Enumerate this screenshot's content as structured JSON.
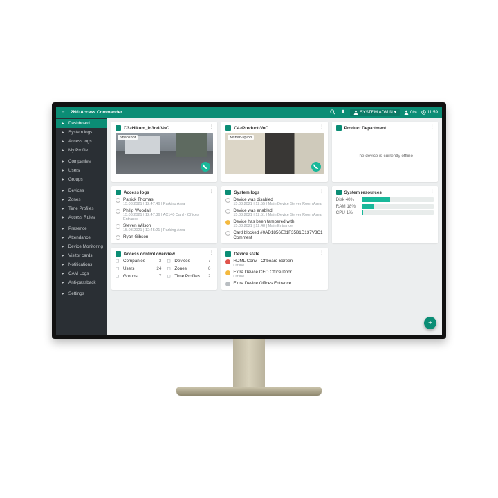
{
  "header": {
    "brand": "2N® Access Commander",
    "user_label": "SYSTEM ADMIN",
    "license": "0/∞",
    "time": "11:59"
  },
  "sidebar": {
    "items": [
      {
        "icon": "dashboard",
        "label": "Dashboard",
        "active": true
      },
      {
        "icon": "log",
        "label": "System logs"
      },
      {
        "icon": "log",
        "label": "Access logs"
      },
      {
        "icon": "user",
        "label": "My Profile"
      },
      {
        "sep": true
      },
      {
        "icon": "building",
        "label": "Companies"
      },
      {
        "icon": "users",
        "label": "Users"
      },
      {
        "icon": "users",
        "label": "Groups"
      },
      {
        "sep": true
      },
      {
        "icon": "device",
        "label": "Devices"
      },
      {
        "icon": "zone",
        "label": "Zones"
      },
      {
        "icon": "clock",
        "label": "Time Profiles"
      },
      {
        "icon": "lock",
        "label": "Access Rules"
      },
      {
        "sep": true
      },
      {
        "icon": "presence",
        "label": "Presence"
      },
      {
        "icon": "attendance",
        "label": "Attendance"
      },
      {
        "icon": "monitor",
        "label": "Device Monitoring"
      },
      {
        "icon": "card",
        "label": "Visitor cards"
      },
      {
        "icon": "bell",
        "label": "Notifications"
      },
      {
        "icon": "camera",
        "label": "CAM Logs"
      },
      {
        "icon": "shield",
        "label": "Anti-passback"
      },
      {
        "sep": true
      },
      {
        "icon": "gear",
        "label": "Settings"
      }
    ]
  },
  "cameras": [
    {
      "title": "C3>Hikum_in3od-VoC",
      "tag": "Snapshot"
    },
    {
      "title": "C4>Product-VoC",
      "tag": "Msnad-vplod"
    },
    {
      "title": "Product Department",
      "offline_text": "The device is currently offline"
    }
  ],
  "access_logs": {
    "title": "Access logs",
    "items": [
      {
        "name": "Patrick Thomas",
        "meta": "15.03.2021 | 12:47:46 | Parking Area"
      },
      {
        "name": "Philip Woodall",
        "meta": "15.03.2021 | 12:47:36 | AC140 Card · Offices Entrance"
      },
      {
        "name": "Steven Wilson",
        "meta": "15.03.2021 | 12:45:21 | Parking Area"
      },
      {
        "name": "Ryan Gibson",
        "meta": ""
      }
    ]
  },
  "system_logs": {
    "title": "System logs",
    "items": [
      {
        "level": "info",
        "title": "Device was disabled",
        "meta": "15.03.2021 | 12:55 | Main Device Server Room Area"
      },
      {
        "level": "info",
        "title": "Device was enabled",
        "meta": "15.03.2021 | 12:51 | Main Device Server Room Area"
      },
      {
        "level": "warn",
        "title": "Device has been tampered with",
        "meta": "15.03.2021 | 12:48 | Main Entrance"
      },
      {
        "level": "info",
        "title": "Card blocked #0AD1856E01F35B1D137V3C1 Comment",
        "meta": ""
      }
    ]
  },
  "overview": {
    "title": "Access control overview",
    "cells": [
      {
        "icon": "building",
        "label": "Companies",
        "value": "3"
      },
      {
        "icon": "device",
        "label": "Devices",
        "value": "7"
      },
      {
        "icon": "users",
        "label": "Users",
        "value": "24"
      },
      {
        "icon": "zone",
        "label": "Zones",
        "value": "6"
      },
      {
        "icon": "users",
        "label": "Groups",
        "value": "7"
      },
      {
        "icon": "clock",
        "label": "Time Profiles",
        "value": "2"
      }
    ]
  },
  "device_state": {
    "title": "Device state",
    "items": [
      {
        "state": "red",
        "title": "HDML Conv · Offboard Screen",
        "meta": "Offline"
      },
      {
        "state": "amber",
        "title": "Extra Device CEO Office Door",
        "meta": "Offline"
      },
      {
        "state": "gray",
        "title": "Extra Device Offices Entrance",
        "meta": ""
      }
    ]
  },
  "resources": {
    "title": "System resources",
    "rows": [
      {
        "label": "Disk 40%",
        "pct": 40
      },
      {
        "label": "RAM 18%",
        "pct": 18
      },
      {
        "label": "CPU 1%",
        "pct": 2
      }
    ]
  }
}
